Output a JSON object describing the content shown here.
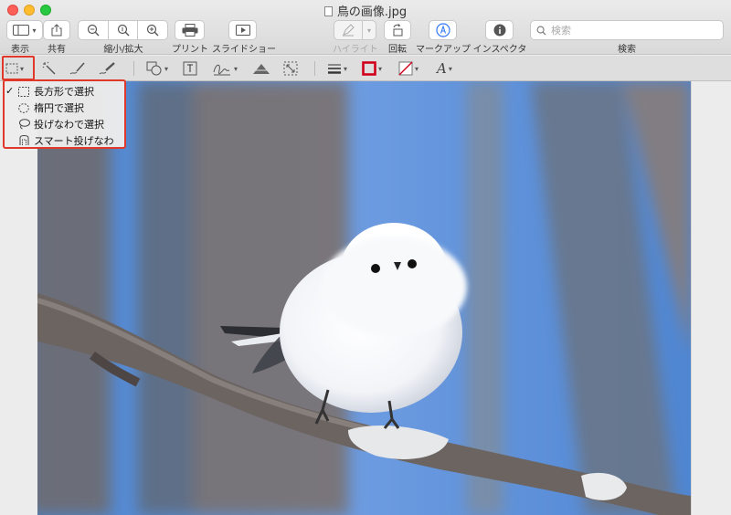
{
  "window": {
    "title": "鳥の画像.jpg"
  },
  "toolbar": {
    "view_label": "表示",
    "share_label": "共有",
    "zoom_label": "縮小/拡大",
    "print_label": "プリント",
    "slideshow_label": "スライドショー",
    "highlight_label": "ハイライト",
    "rotate_label": "回転",
    "markup_label": "マークアップ",
    "inspector_label": "インスペクタ",
    "search_label": "検索",
    "search_placeholder": "検索"
  },
  "markup_tools": [
    "selection-tools",
    "instant-alpha",
    "sketch",
    "draw",
    "shapes",
    "text",
    "sign",
    "adjust-color",
    "adjust-size",
    "shape-style",
    "border-color",
    "fill-color",
    "text-style"
  ],
  "selection_menu": {
    "items": [
      {
        "label": "長方形で選択",
        "checked": true,
        "icon": "rect-select-icon"
      },
      {
        "label": "楕円で選択",
        "checked": false,
        "icon": "ellipse-select-icon"
      },
      {
        "label": "投げなわで選択",
        "checked": false,
        "icon": "lasso-icon"
      },
      {
        "label": "スマート投げなわ",
        "checked": false,
        "icon": "smart-lasso-icon"
      }
    ],
    "checkmark": "✓"
  },
  "colors": {
    "annotation_red": "#e0392b",
    "sky_blue": "#5b8fd6"
  }
}
